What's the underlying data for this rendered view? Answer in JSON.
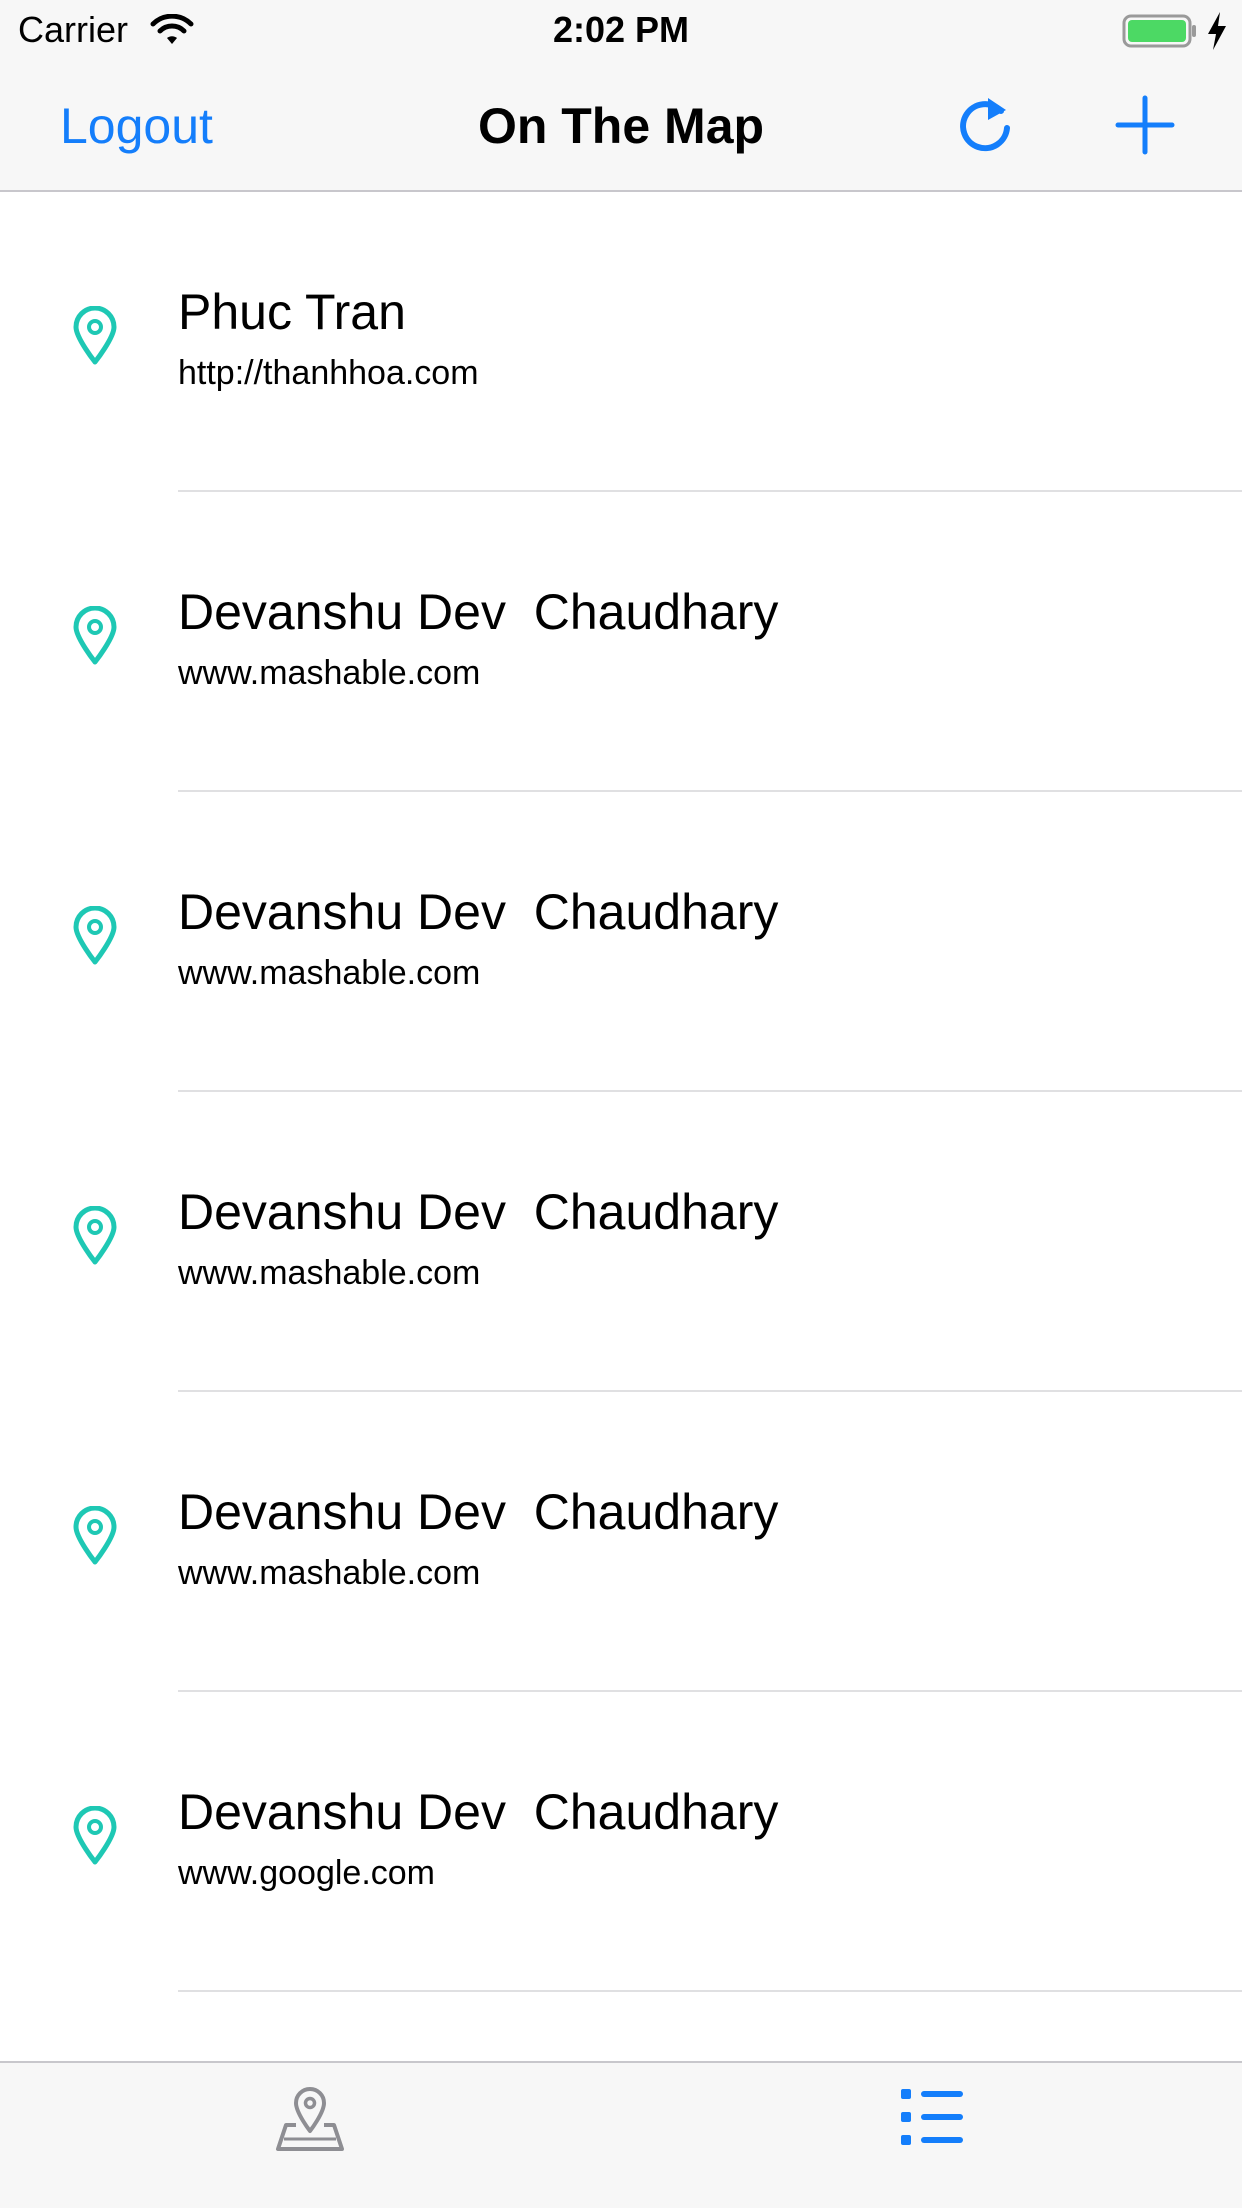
{
  "status_bar": {
    "carrier": "Carrier",
    "time": "2:02 PM"
  },
  "nav_bar": {
    "logout_label": "Logout",
    "title": "On The Map",
    "refresh_icon": "refresh-icon",
    "add_icon": "plus-icon"
  },
  "colors": {
    "accent": "#147efb",
    "pin": "#1ec8b4",
    "tab_inactive": "#8e8e93",
    "battery": "#4cd964"
  },
  "list": {
    "items": [
      {
        "name": "Phuc Tran",
        "url": "http://thanhhoa.com"
      },
      {
        "name": "Devanshu Dev  Chaudhary",
        "url": "www.mashable.com"
      },
      {
        "name": "Devanshu Dev  Chaudhary",
        "url": "www.mashable.com"
      },
      {
        "name": "Devanshu Dev  Chaudhary",
        "url": "www.mashable.com"
      },
      {
        "name": "Devanshu Dev  Chaudhary",
        "url": "www.mashable.com"
      },
      {
        "name": "Devanshu Dev  Chaudhary",
        "url": "www.google.com"
      }
    ]
  },
  "tab_bar": {
    "tabs": [
      {
        "icon": "map-pin-icon",
        "selected": false
      },
      {
        "icon": "list-icon",
        "selected": true
      }
    ]
  }
}
